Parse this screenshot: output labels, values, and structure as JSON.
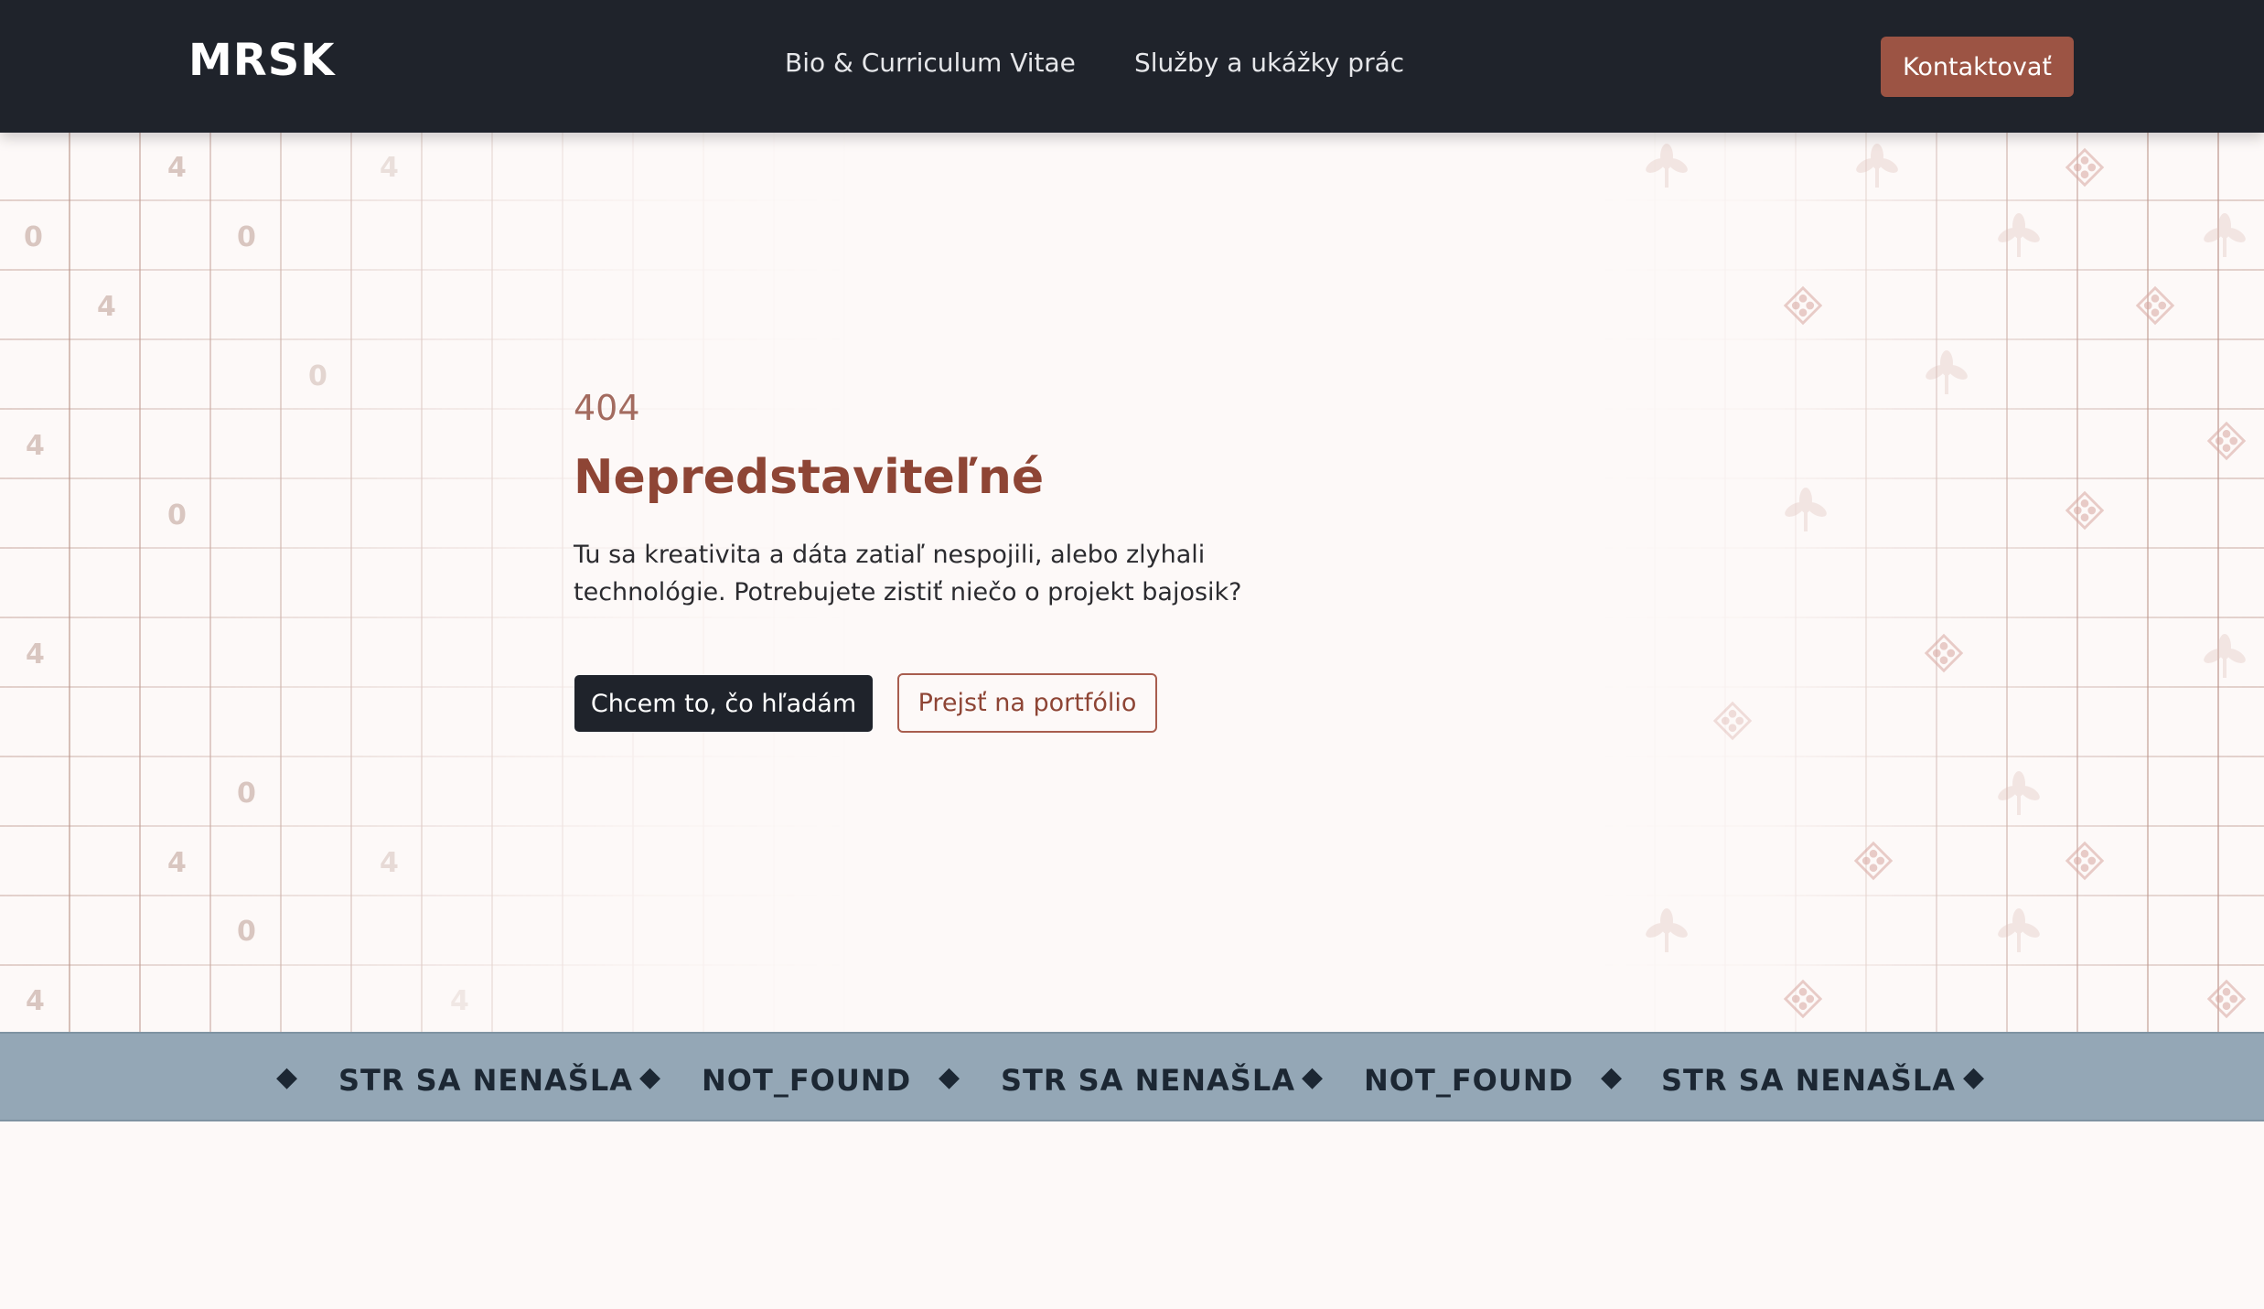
{
  "nav": {
    "logo": "MRSK",
    "links": [
      "Bio & Curriculum Vitae",
      "Služby a ukážky prác"
    ],
    "contact_label": "Kontaktovať"
  },
  "error": {
    "code": "404",
    "title": "Nepredstaviteľné",
    "text": "Tu sa kreativita a dáta zatiaľ nespojili, alebo zlyhali technológie. Potrebujete zistiť niečo o projekt bajosik?",
    "primary_button": "Chcem to, čo hľadám",
    "secondary_button": "Prejsť na portfólio"
  },
  "background_digits": [
    "4",
    "0",
    "4"
  ],
  "band": {
    "items": [
      "STR SA NENAŠLA",
      "NOT_FOUND",
      "STR SA NENAŠLA",
      "NOT_FOUND",
      "STR SA NENAŠLA"
    ],
    "separator": "◆"
  },
  "colors": {
    "nav_bg": "#1f232b",
    "accent": "#9c5444",
    "title": "#8e4535",
    "band_bg": "#94a7b6",
    "page_bg": "#fdf9f8"
  },
  "icons": {
    "separator": "diamond-icon",
    "ornament": "folk-diamond-ornament-icon",
    "leaf": "folk-flower-ornament-icon"
  }
}
